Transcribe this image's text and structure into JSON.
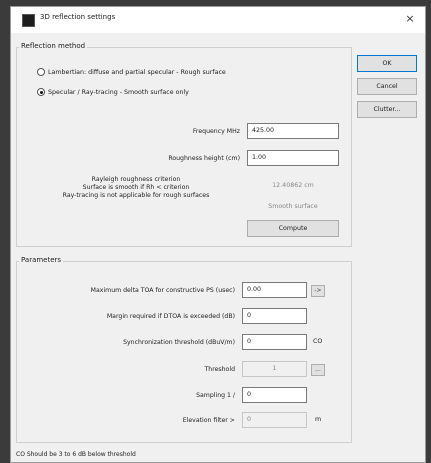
{
  "window": {
    "title": "3D reflection settings",
    "close_glyph": "×"
  },
  "reflection_method": {
    "group_label": "Reflection method",
    "options": [
      {
        "label": "Lambertian: diffuse and partial specular - Rough surface",
        "selected": false
      },
      {
        "label": "Specular / Ray-tracing - Smooth surface only",
        "selected": true
      }
    ],
    "frequency": {
      "label": "Frequency MHz",
      "value": "425.00"
    },
    "roughness": {
      "label": "Roughness height (cm)",
      "value": "1.00"
    },
    "criterion": {
      "lines": [
        "Rayleigh roughness criterion",
        "Surface is smooth if Rh < criterion",
        "Ray-tracing is not applicable for rough surfaces"
      ],
      "result_value": "12.40862 cm",
      "result_text": "Smooth surface"
    },
    "compute_label": "Compute"
  },
  "parameters": {
    "group_label": "Parameters",
    "max_delta_toa": {
      "label": "Maximum delta TOA for constructive PS (usec)",
      "value": "0.00",
      "button": "->"
    },
    "margin": {
      "label": "Margin required if DTOA is exceeded (dB)",
      "value": "0"
    },
    "sync_threshold": {
      "label": "Synchronization threshold (dBuV/m)",
      "value": "0",
      "unit": "CO"
    },
    "threshold": {
      "label": "Threshold",
      "value": "1",
      "button": "..."
    },
    "sampling": {
      "label": "Sampling 1 /",
      "value": "0"
    },
    "elevation": {
      "label": "Elevation filter >",
      "value": "0",
      "unit": "m"
    }
  },
  "buttons": {
    "ok": "OK",
    "cancel": "Cancel",
    "clutter": "Clutter..."
  },
  "footer": "CO Should be 3 to 6 dB below threshold",
  "colors": {
    "dialog_bg": "#f0f0f0",
    "backdrop": "#3b3b3b",
    "focus_border": "#0078d7"
  }
}
